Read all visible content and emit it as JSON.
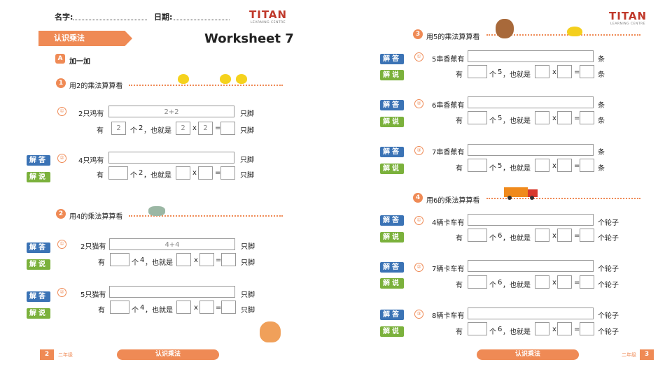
{
  "brand": {
    "name": "TITAN",
    "tagline": "LEARNING CENTRE"
  },
  "header": {
    "name_label": "名字:",
    "date_label": "日期:"
  },
  "topic_banner": "认识乘法",
  "worksheet_title": "Worksheet 7",
  "part": {
    "badge": "A",
    "title": "加一加"
  },
  "buttons": {
    "answer": "解答",
    "explain": "解说"
  },
  "common": {
    "have": "有",
    "ge": "个",
    "also": "，也就是",
    "times": "x",
    "equals": "="
  },
  "sections": [
    {
      "num": "1",
      "title": "用2的乘法算算看",
      "factor": "2",
      "items": [
        {
          "idx": "①",
          "q": "2只鸡有",
          "long_value": "2+2",
          "v1": "2",
          "v2": "2",
          "v3": "2",
          "unit": "只脚"
        },
        {
          "idx": "②",
          "q": "4只鸡有",
          "long_value": "",
          "v1": "",
          "v2": "",
          "v3": "",
          "unit": "只脚"
        }
      ]
    },
    {
      "num": "2",
      "title": "用4的乘法算算看",
      "factor": "4",
      "items": [
        {
          "idx": "①",
          "q": "2只猫有",
          "long_value": "4+4",
          "unit": "只脚"
        },
        {
          "idx": "②",
          "q": "5只猫有",
          "long_value": "",
          "unit": "只脚"
        }
      ]
    },
    {
      "num": "3",
      "title": "用5的乘法算算看",
      "factor": "5",
      "items": [
        {
          "idx": "①",
          "q": "5串香蕉有",
          "unit": "条"
        },
        {
          "idx": "②",
          "q": "6串香蕉有",
          "unit": "条"
        },
        {
          "idx": "③",
          "q": "7串香蕉有",
          "unit": "条"
        }
      ]
    },
    {
      "num": "4",
      "title": "用6的乘法算算看",
      "factor": "6",
      "items": [
        {
          "idx": "①",
          "q": "4辆卡车有",
          "unit": "个轮子"
        },
        {
          "idx": "②",
          "q": "7辆卡车有",
          "unit": "个轮子"
        },
        {
          "idx": "③",
          "q": "8辆卡车有",
          "unit": "个轮子"
        }
      ]
    }
  ],
  "footer": {
    "left_page": "2",
    "right_page": "3",
    "grade": "二年级",
    "topic": "认识乘法"
  },
  "colors": {
    "accent": "#ef8a55",
    "answer_blue": "#3b73b5",
    "explain_green": "#7bb13c",
    "brand_red": "#c0392b"
  }
}
